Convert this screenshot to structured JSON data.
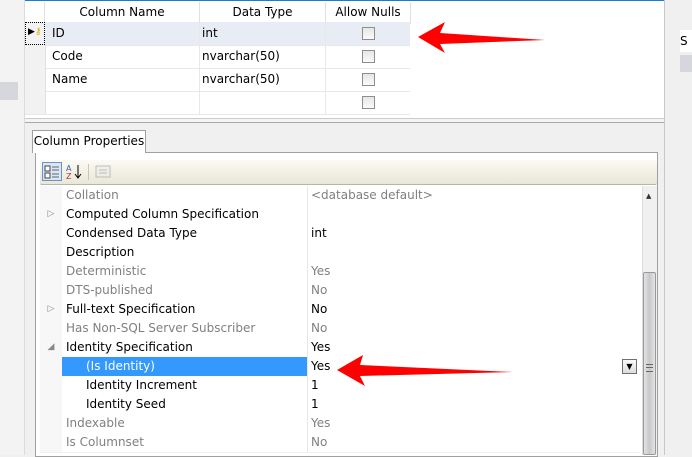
{
  "grid": {
    "headers": [
      "Column Name",
      "Data Type",
      "Allow Nulls"
    ],
    "rows": [
      {
        "name": "ID",
        "type": "int",
        "allow_nulls": false,
        "primary_key": true
      },
      {
        "name": "Code",
        "type": "nvarchar(50)",
        "allow_nulls": false
      },
      {
        "name": "Name",
        "type": "nvarchar(50)",
        "allow_nulls": false
      },
      {
        "name": "",
        "type": "",
        "allow_nulls": false
      }
    ]
  },
  "properties_tab": "Column Properties",
  "toolbar": {
    "icons": [
      "categorized-icon",
      "alphabetical-sort-icon",
      "property-pages-icon"
    ]
  },
  "properties": [
    {
      "name": "Collation",
      "value": "<database default>",
      "disabled": true
    },
    {
      "name": "Computed Column Specification",
      "value": "",
      "expander": "▷"
    },
    {
      "name": "Condensed Data Type",
      "value": "int"
    },
    {
      "name": "Description",
      "value": ""
    },
    {
      "name": "Deterministic",
      "value": "Yes",
      "disabled": true
    },
    {
      "name": "DTS-published",
      "value": "No",
      "disabled": true
    },
    {
      "name": "Full-text Specification",
      "value": "No",
      "expander": "▷"
    },
    {
      "name": "Has Non-SQL Server Subscriber",
      "value": "No",
      "disabled": true
    },
    {
      "name": "Identity Specification",
      "value": "Yes",
      "expander": "◢"
    },
    {
      "name": "(Is Identity)",
      "value": "Yes",
      "sub": true,
      "selected": true
    },
    {
      "name": "Identity Increment",
      "value": "1",
      "sub": true
    },
    {
      "name": "Identity Seed",
      "value": "1",
      "sub": true
    },
    {
      "name": "Indexable",
      "value": "Yes",
      "disabled": true
    },
    {
      "name": "Is Columnset",
      "value": "No",
      "disabled": true
    }
  ],
  "right_panel_letter": "S",
  "colors": {
    "selection": "#3399ff",
    "arrow": "#ff0000"
  }
}
